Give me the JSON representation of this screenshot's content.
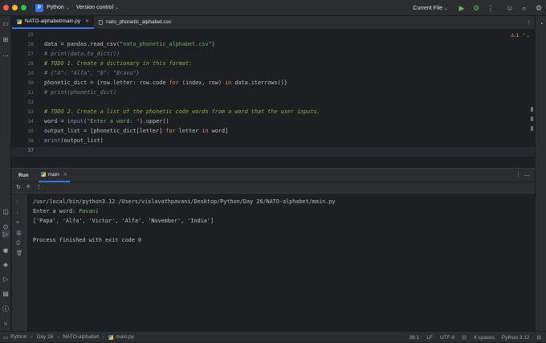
{
  "titlebar": {
    "project_badge": "P",
    "project_name": "Python",
    "vcs": "Version control",
    "run_config": "Current File",
    "colors": {
      "close": "#ff5f57",
      "min": "#febc2e",
      "max": "#28c840",
      "accent": "#3574f0"
    }
  },
  "tabs": [
    {
      "label": "NATO-alphabet/main.py",
      "active": true
    },
    {
      "label": "nato_phonetic_alphabet.csv",
      "active": false
    }
  ],
  "editor": {
    "inspection_badge": "1",
    "lines": [
      {
        "num": "25",
        "text": ""
      },
      {
        "num": "26",
        "text": "data = pandas.read_csv(\"nato_phonetic_alphabet.csv\")"
      },
      {
        "num": "27",
        "text": "# print(data.to_dict())"
      },
      {
        "num": "28",
        "text": "# TODO 1. Create a dictionary in this format:"
      },
      {
        "num": "29",
        "text": "# {\"A\": \"Alfa\", \"B\": \"Bravo\"}"
      },
      {
        "num": "30",
        "text": "phonetic_dict = {row.letter: row.code for (index, row) in data.iterrows()}"
      },
      {
        "num": "31",
        "text": "# print(phonetic_dict)"
      },
      {
        "num": "32",
        "text": ""
      },
      {
        "num": "33",
        "text": "# TODO 2. Create a list of the phonetic code words from a word that the user inputs."
      },
      {
        "num": "34",
        "text": "word = input(\"Enter a word: \").upper()"
      },
      {
        "num": "35",
        "text": "output_list = [phonetic_dict[letter] for letter in word]"
      },
      {
        "num": "36",
        "text": "print(output_list)"
      },
      {
        "num": "37",
        "text": ""
      }
    ]
  },
  "run": {
    "title": "Run",
    "tab_label": "main",
    "console": [
      "/usr/local/bin/python3.12 /Users/vislavathpavani/Desktop/Python/Day 26/NATO-alphabet/main.py",
      "Enter a word: ",
      "['Papa', 'Alfa', 'Victor', 'Alfa', 'November', 'India']",
      "",
      "Process finished with exit code 0"
    ],
    "user_input": "Pavani"
  },
  "statusbar": {
    "breadcrumbs": [
      "Python",
      "Day 26",
      "NATO-alphabet",
      "main.py"
    ],
    "position": "36:1",
    "line_sep": "LF",
    "encoding": "UTF-8",
    "indent": "4 spaces",
    "interpreter": "Python 3.12"
  }
}
